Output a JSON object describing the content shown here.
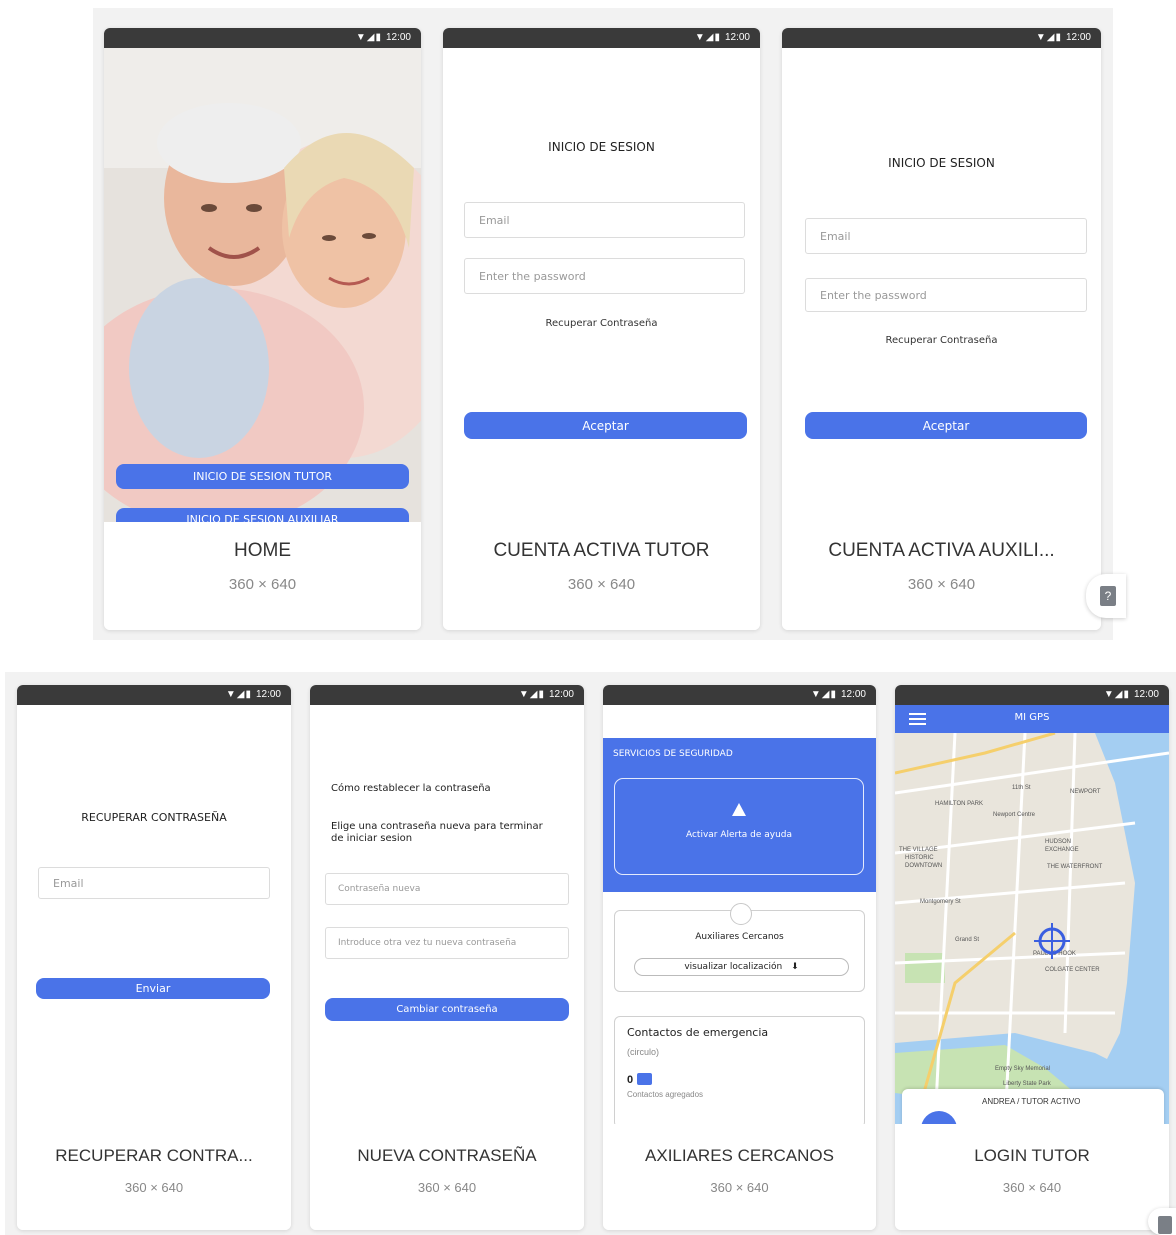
{
  "status": {
    "time": "12:00",
    "icons": "▼◢▮"
  },
  "cards": {
    "home": {
      "title": "HOME",
      "size": "360 × 640",
      "btn_tutor": "INICIO DE SESION TUTOR",
      "btn_auxiliar": "INICIO DE SESION AUXILIAR"
    },
    "tutor": {
      "title": "CUENTA ACTIVA TUTOR",
      "size": "360 × 640",
      "heading": "INICIO DE SESION",
      "email_placeholder": "Email",
      "password_placeholder": "Enter the password",
      "recover": "Recuperar Contraseña",
      "accept": "Aceptar"
    },
    "auxiliar": {
      "title": "CUENTA ACTIVA AUXILI...",
      "size": "360 × 640",
      "heading": "INICIO DE SESION",
      "email_placeholder": "Email",
      "password_placeholder": "Enter the password",
      "recover": "Recuperar Contraseña",
      "accept": "Aceptar"
    },
    "recover": {
      "title": "RECUPERAR CONTRA...",
      "size": "360 × 640",
      "heading": "RECUPERAR CONTRASEÑA",
      "email_placeholder": "Email",
      "send": "Enviar"
    },
    "newpass": {
      "title": "NUEVA CONTRASEÑA",
      "size": "360 × 640",
      "heading": "Cómo restablecer la contraseña",
      "subheading": "Elige una contraseña nueva para terminar de iniciar sesion",
      "new_placeholder": "Contraseña nueva",
      "repeat_placeholder": "Introduce otra vez tu nueva contraseña",
      "change": "Cambiar contraseña"
    },
    "nearby": {
      "title": "AXILIARES CERCANOS",
      "size": "360 × 640",
      "section": "SERVICIOS DE SEGURIDAD",
      "alert": "Activar Alerta de ayuda",
      "aux_title": "Auxiliares Cercanos",
      "view_location": "visualizar localización",
      "contacts_title": "Contactos de emergencia",
      "contacts_sub": "(circulo)",
      "contacts_count": "0",
      "contacts_added": "Contactos agregados"
    },
    "login": {
      "title": "LOGIN TUTOR",
      "size": "360 × 640",
      "appbar_title": "MI GPS",
      "bottom_sheet": "ANDREA / TUTOR ACTIVO",
      "map_labels": [
        "11th St",
        "NEWPORT",
        "HAMILTON PARK",
        "Newport Centre",
        "HUDSON EXCHANGE",
        "THE VILLAGE",
        "HISTORIC DOWNTOWN",
        "THE WATERFRONT",
        "Montgomery St",
        "Grand St",
        "PAULUS HOOK",
        "COLGATE CENTER",
        "Empty Sky Memorial",
        "Liberty State Park"
      ]
    }
  },
  "colors": {
    "accent": "#4a73e8",
    "statusbar": "#3a3a3a"
  }
}
